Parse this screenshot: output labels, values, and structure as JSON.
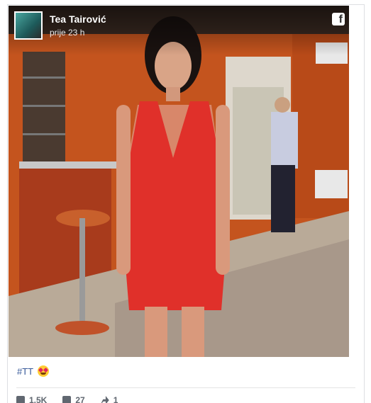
{
  "post": {
    "author": "Tea Tairović",
    "timestamp": "prije 23 h",
    "caption": "#TT",
    "caption_emoji": "heart-eyes-emoji",
    "brand_icon": "facebook-icon",
    "brand_glyph": "f"
  },
  "stats": {
    "likes": "1,5K",
    "comments": "27",
    "shares": "1"
  },
  "colors": {
    "link": "#365899",
    "muted": "#606770",
    "border": "#dddfe2"
  }
}
